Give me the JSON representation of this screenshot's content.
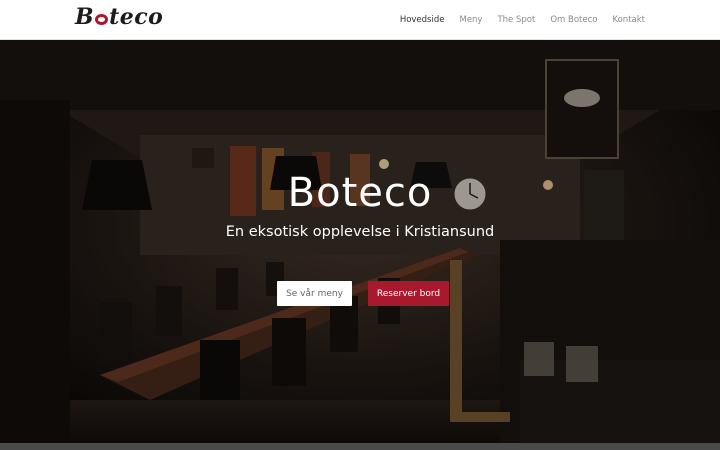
{
  "brand": {
    "logo_first": "B",
    "logo_rest": "teco",
    "logo_accent_color": "#a8192e"
  },
  "nav": {
    "items": [
      {
        "label": "Hovedside",
        "active": true
      },
      {
        "label": "Meny",
        "active": false
      },
      {
        "label": "The Spot",
        "active": false
      },
      {
        "label": "Om Boteco",
        "active": false
      },
      {
        "label": "Kontakt",
        "active": false
      }
    ]
  },
  "hero": {
    "title": "Boteco",
    "subtitle": "En eksotisk opplevelse i Kristiansund",
    "primary_button": "Se vår meny",
    "secondary_button": "Reserver bord",
    "accent_color": "#a8192e"
  }
}
